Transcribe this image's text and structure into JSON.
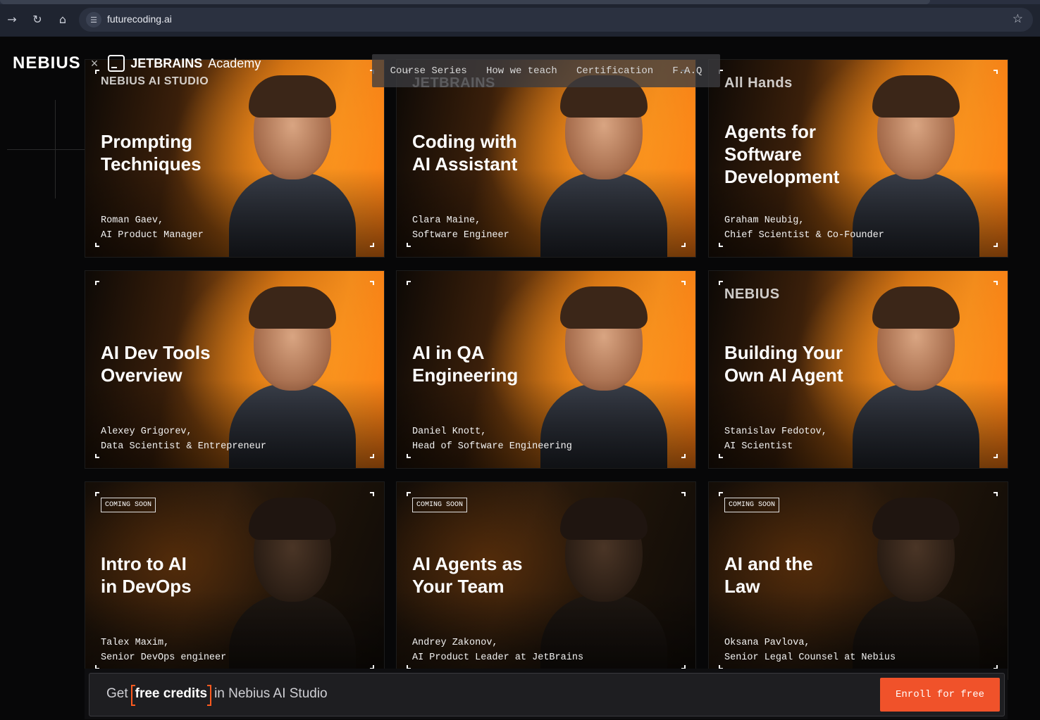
{
  "browser": {
    "url": "futurecoding.ai",
    "back_icon": "→",
    "reload_icon": "↻",
    "home_icon": "⌂",
    "site_settings_icon": "☰",
    "bookmark_icon": "☆"
  },
  "brand": {
    "nebius": "NEBIUS",
    "times": "×",
    "jetbrains": "JETBRAINS",
    "academy": "Academy"
  },
  "nav": [
    "Course Series",
    "How we teach",
    "Certification",
    "F.A.Q"
  ],
  "cards": [
    {
      "logo": "NEBIUS AI STUDIO",
      "badge": "",
      "title": "Prompting\nTechniques",
      "person": "Roman Gaev,\nAI Product Manager",
      "style": "warm"
    },
    {
      "logo": "JETBRAINS",
      "badge": "",
      "title": "Coding with\nAI Assistant",
      "person": "Clara Maine,\nSoftware Engineer",
      "style": "warm"
    },
    {
      "logo": "All Hands",
      "badge": "",
      "title": "Agents for\nSoftware\nDevelopment",
      "person": "Graham Neubig,\nChief Scientist & Co-Founder",
      "style": "warm"
    },
    {
      "logo": "",
      "badge": "",
      "title": "AI Dev Tools\nOverview",
      "person": "Alexey Grigorev,\nData Scientist & Entrepreneur",
      "style": "warm"
    },
    {
      "logo": "",
      "badge": "",
      "title": "AI in QA\nEngineering",
      "person": "Daniel Knott,\nHead of Software Engineering",
      "style": "warm"
    },
    {
      "logo": "NEBIUS",
      "badge": "",
      "title": "Building Your\nOwn AI Agent",
      "person": "Stanislav Fedotov,\nAI Scientist",
      "style": "warm"
    },
    {
      "logo": "",
      "badge": "COMING SOON",
      "title": "Intro to AI\nin DevOps",
      "person": "Talex Maxim,\nSenior DevOps engineer",
      "style": "dark"
    },
    {
      "logo": "",
      "badge": "COMING SOON",
      "title": "AI Agents as\nYour Team",
      "person": "Andrey Zakonov,\nAI Product Leader at JetBrains",
      "style": "dark"
    },
    {
      "logo": "",
      "badge": "COMING SOON",
      "title": "AI and the\nLaw",
      "person": "Oksana Pavlova,\nSenior Legal Counsel at Nebius",
      "style": "dark"
    }
  ],
  "banner": {
    "prefix": "Get",
    "highlight": "free credits",
    "suffix": "in Nebius AI Studio",
    "cta": "Enroll for free"
  },
  "colors": {
    "accent": "#f0522a",
    "orange": "#f08a1c"
  }
}
